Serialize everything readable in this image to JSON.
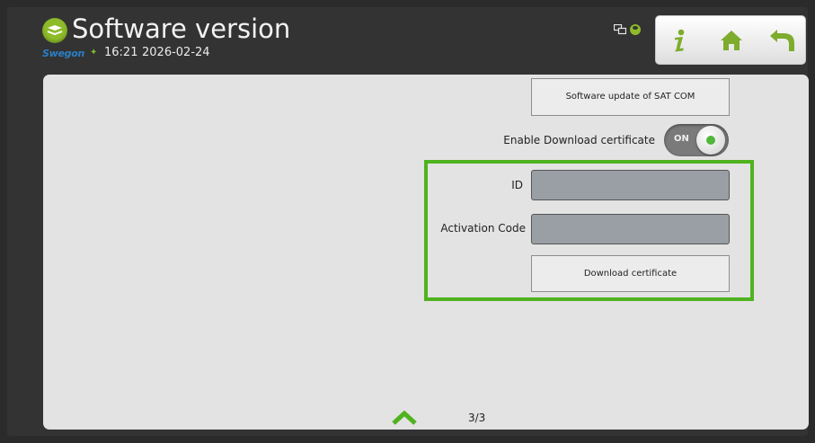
{
  "header": {
    "title": "Software version",
    "brand": "Swegon",
    "time": "16:21",
    "date": "2026-02-24"
  },
  "status_icons": [
    "network-icon",
    "user-icon"
  ],
  "nav": [
    "info-icon",
    "home-icon",
    "back-icon"
  ],
  "main": {
    "sat_update_button": "Software update of SAT COM",
    "enable_cert_label": "Enable Download certificate",
    "toggle_state": "ON",
    "id_label": "ID",
    "id_value": "",
    "activation_label": "Activation Code",
    "activation_value": "",
    "download_button": "Download certificate"
  },
  "pagination": {
    "page": "3/3"
  },
  "colors": {
    "accent_green": "#4fb31f",
    "brand_blue": "#2a7fc6",
    "icon_green": "#8dbb2a",
    "field_gray": "#9a9fa5"
  }
}
